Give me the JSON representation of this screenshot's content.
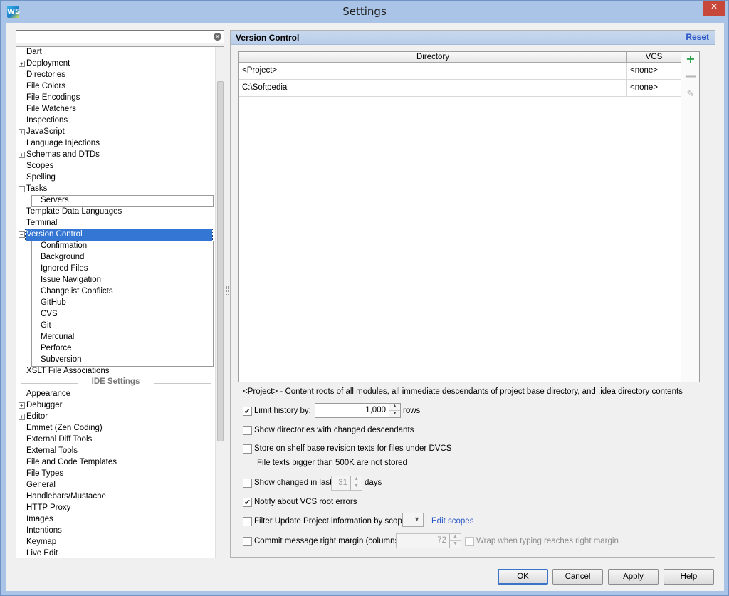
{
  "window": {
    "title": "Settings",
    "app_icon": "WS",
    "close_glyph": "✕"
  },
  "search": {
    "value": "",
    "placeholder": "",
    "clear_glyph": "✕"
  },
  "tree": {
    "project_items": [
      {
        "label": "Dart",
        "expander": ""
      },
      {
        "label": "Deployment",
        "expander": "+"
      },
      {
        "label": "Directories",
        "expander": ""
      },
      {
        "label": "File Colors",
        "expander": ""
      },
      {
        "label": "File Encodings",
        "expander": ""
      },
      {
        "label": "File Watchers",
        "expander": ""
      },
      {
        "label": "Inspections",
        "expander": ""
      },
      {
        "label": "JavaScript",
        "expander": "+"
      },
      {
        "label": "Language Injections",
        "expander": ""
      },
      {
        "label": "Schemas and DTDs",
        "expander": "+"
      },
      {
        "label": "Scopes",
        "expander": ""
      },
      {
        "label": "Spelling",
        "expander": ""
      },
      {
        "label": "Tasks",
        "expander": "−"
      }
    ],
    "tasks_children": [
      "Servers"
    ],
    "after_tasks": [
      "Template Data Languages",
      "Terminal"
    ],
    "version_control": {
      "label": "Version Control",
      "expander": "−"
    },
    "vc_children": [
      "Confirmation",
      "Background",
      "Ignored Files",
      "Issue Navigation",
      "Changelist Conflicts",
      "GitHub",
      "CVS",
      "Git",
      "Mercurial",
      "Perforce",
      "Subversion"
    ],
    "after_vc": [
      "XSLT File Associations"
    ],
    "ide_settings_label": "IDE Settings",
    "ide_items": [
      {
        "label": "Appearance",
        "expander": ""
      },
      {
        "label": "Debugger",
        "expander": "+"
      },
      {
        "label": "Editor",
        "expander": "+"
      },
      {
        "label": "Emmet (Zen Coding)",
        "expander": ""
      },
      {
        "label": "External Diff Tools",
        "expander": ""
      },
      {
        "label": "External Tools",
        "expander": ""
      },
      {
        "label": "File and Code Templates",
        "expander": ""
      },
      {
        "label": "File Types",
        "expander": ""
      },
      {
        "label": "General",
        "expander": ""
      },
      {
        "label": "Handlebars/Mustache",
        "expander": ""
      },
      {
        "label": "HTTP Proxy",
        "expander": ""
      },
      {
        "label": "Images",
        "expander": ""
      },
      {
        "label": "Intentions",
        "expander": ""
      },
      {
        "label": "Keymap",
        "expander": ""
      },
      {
        "label": "Live Edit",
        "expander": ""
      }
    ]
  },
  "panel": {
    "title": "Version Control",
    "reset_label": "Reset",
    "table": {
      "headers": [
        "Directory",
        "VCS"
      ],
      "rows": [
        [
          "<Project>",
          "<none>"
        ],
        [
          "C:\\Softpedia",
          "<none>"
        ]
      ],
      "add_glyph": "+",
      "remove_glyph": "—",
      "edit_glyph": "✎"
    },
    "note": "<Project> - Content roots of all modules, all immediate descendants of project base directory, and .idea directory contents",
    "options": {
      "limit_history": {
        "label": "Limit history by:",
        "checked": "✔",
        "value": "1,000",
        "suffix": "rows"
      },
      "show_dirs": {
        "label": "Show directories with changed descendants",
        "checked": ""
      },
      "store_shelf": {
        "label": "Store on shelf base revision texts for files under DVCS",
        "checked": "",
        "hint": "File texts bigger than 500K are not stored"
      },
      "show_changed": {
        "label": "Show changed in last",
        "checked": "",
        "value": "31",
        "suffix": "days"
      },
      "notify_vcs": {
        "label": "Notify about VCS root errors",
        "checked": "✔"
      },
      "filter_update": {
        "label": "Filter Update Project information by scope",
        "checked": "",
        "combo_value": "",
        "edit_link": "Edit scopes"
      },
      "commit_margin": {
        "label": "Commit message right margin (columns):",
        "checked": "",
        "value": "72",
        "wrap_label": "Wrap when typing reaches right margin",
        "wrap_checked": ""
      }
    }
  },
  "buttons": {
    "ok": "OK",
    "cancel": "Cancel",
    "apply": "Apply",
    "help": "Help"
  },
  "colors": {
    "selection": "#3476d3",
    "link": "#2a56c6",
    "add_icon": "#2ea44f",
    "header_bg": "#c8d9ef"
  }
}
